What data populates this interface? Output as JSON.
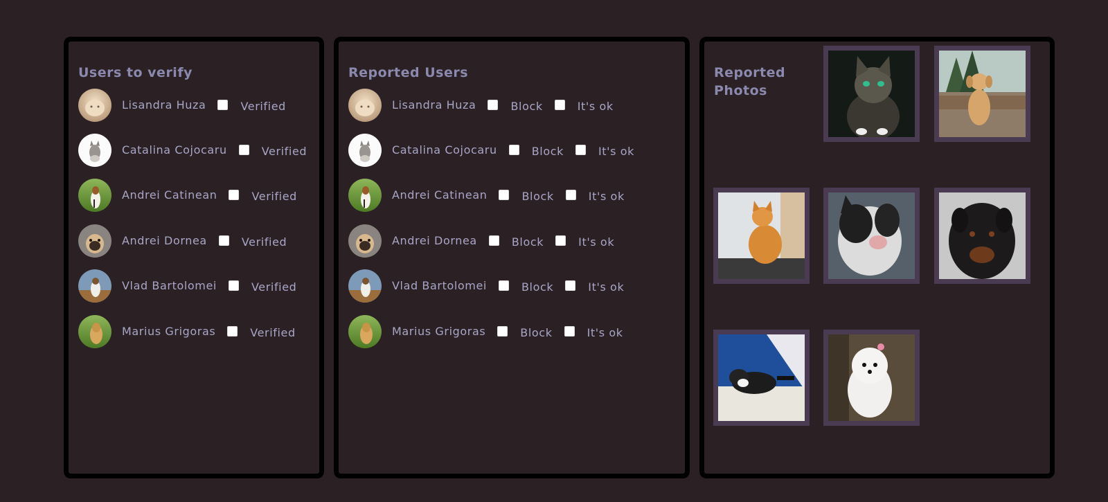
{
  "verify_panel": {
    "title": "Users to verify",
    "users": [
      {
        "name": "Lisandra Huza",
        "checkbox_label": "Verified",
        "avatar": "cat-fluffy-photo"
      },
      {
        "name": "Catalina Cojocaru",
        "checkbox_label": "Verified",
        "avatar": "kitten-white-photo"
      },
      {
        "name": "Andrei Catinean",
        "checkbox_label": "Verified",
        "avatar": "beagle-grass-photo"
      },
      {
        "name": "Andrei Dornea",
        "checkbox_label": "Verified",
        "avatar": "pug-photo"
      },
      {
        "name": "Vlad Bartolomei",
        "checkbox_label": "Verified",
        "avatar": "dog-outdoor-photo"
      },
      {
        "name": "Marius Grigoras",
        "checkbox_label": "Verified",
        "avatar": "labrador-grass-photo"
      }
    ]
  },
  "reported_users_panel": {
    "title": "Reported Users",
    "users": [
      {
        "name": "Lisandra Huza",
        "block_label": "Block",
        "ok_label": "It's ok"
      },
      {
        "name": "Catalina Cojocaru",
        "block_label": "Block",
        "ok_label": "It's ok"
      },
      {
        "name": "Andrei Catinean",
        "block_label": "Block",
        "ok_label": "It's ok"
      },
      {
        "name": "Andrei Dornea",
        "block_label": "Block",
        "ok_label": "It's ok"
      },
      {
        "name": "Vlad Bartolomei",
        "block_label": "Block",
        "ok_label": "It's ok"
      },
      {
        "name": "Marius Grigoras",
        "block_label": "Block",
        "ok_label": "It's ok"
      }
    ]
  },
  "reported_photos_panel": {
    "title": "Reported Photos",
    "photos": [
      {
        "subject": "tabby-cat-green-eyes"
      },
      {
        "subject": "golden-puppy-sitting"
      },
      {
        "subject": "orange-cat-window"
      },
      {
        "subject": "bulldog-closeup"
      },
      {
        "subject": "rottweiler"
      },
      {
        "subject": "black-white-puppy-bed"
      },
      {
        "subject": "white-maltese"
      }
    ]
  },
  "colors": {
    "background": "#2b2125",
    "panel_border": "#000000",
    "title_text": "#8b89ad",
    "body_text": "#a8a6c6",
    "photo_frame": "#4b3b52"
  }
}
